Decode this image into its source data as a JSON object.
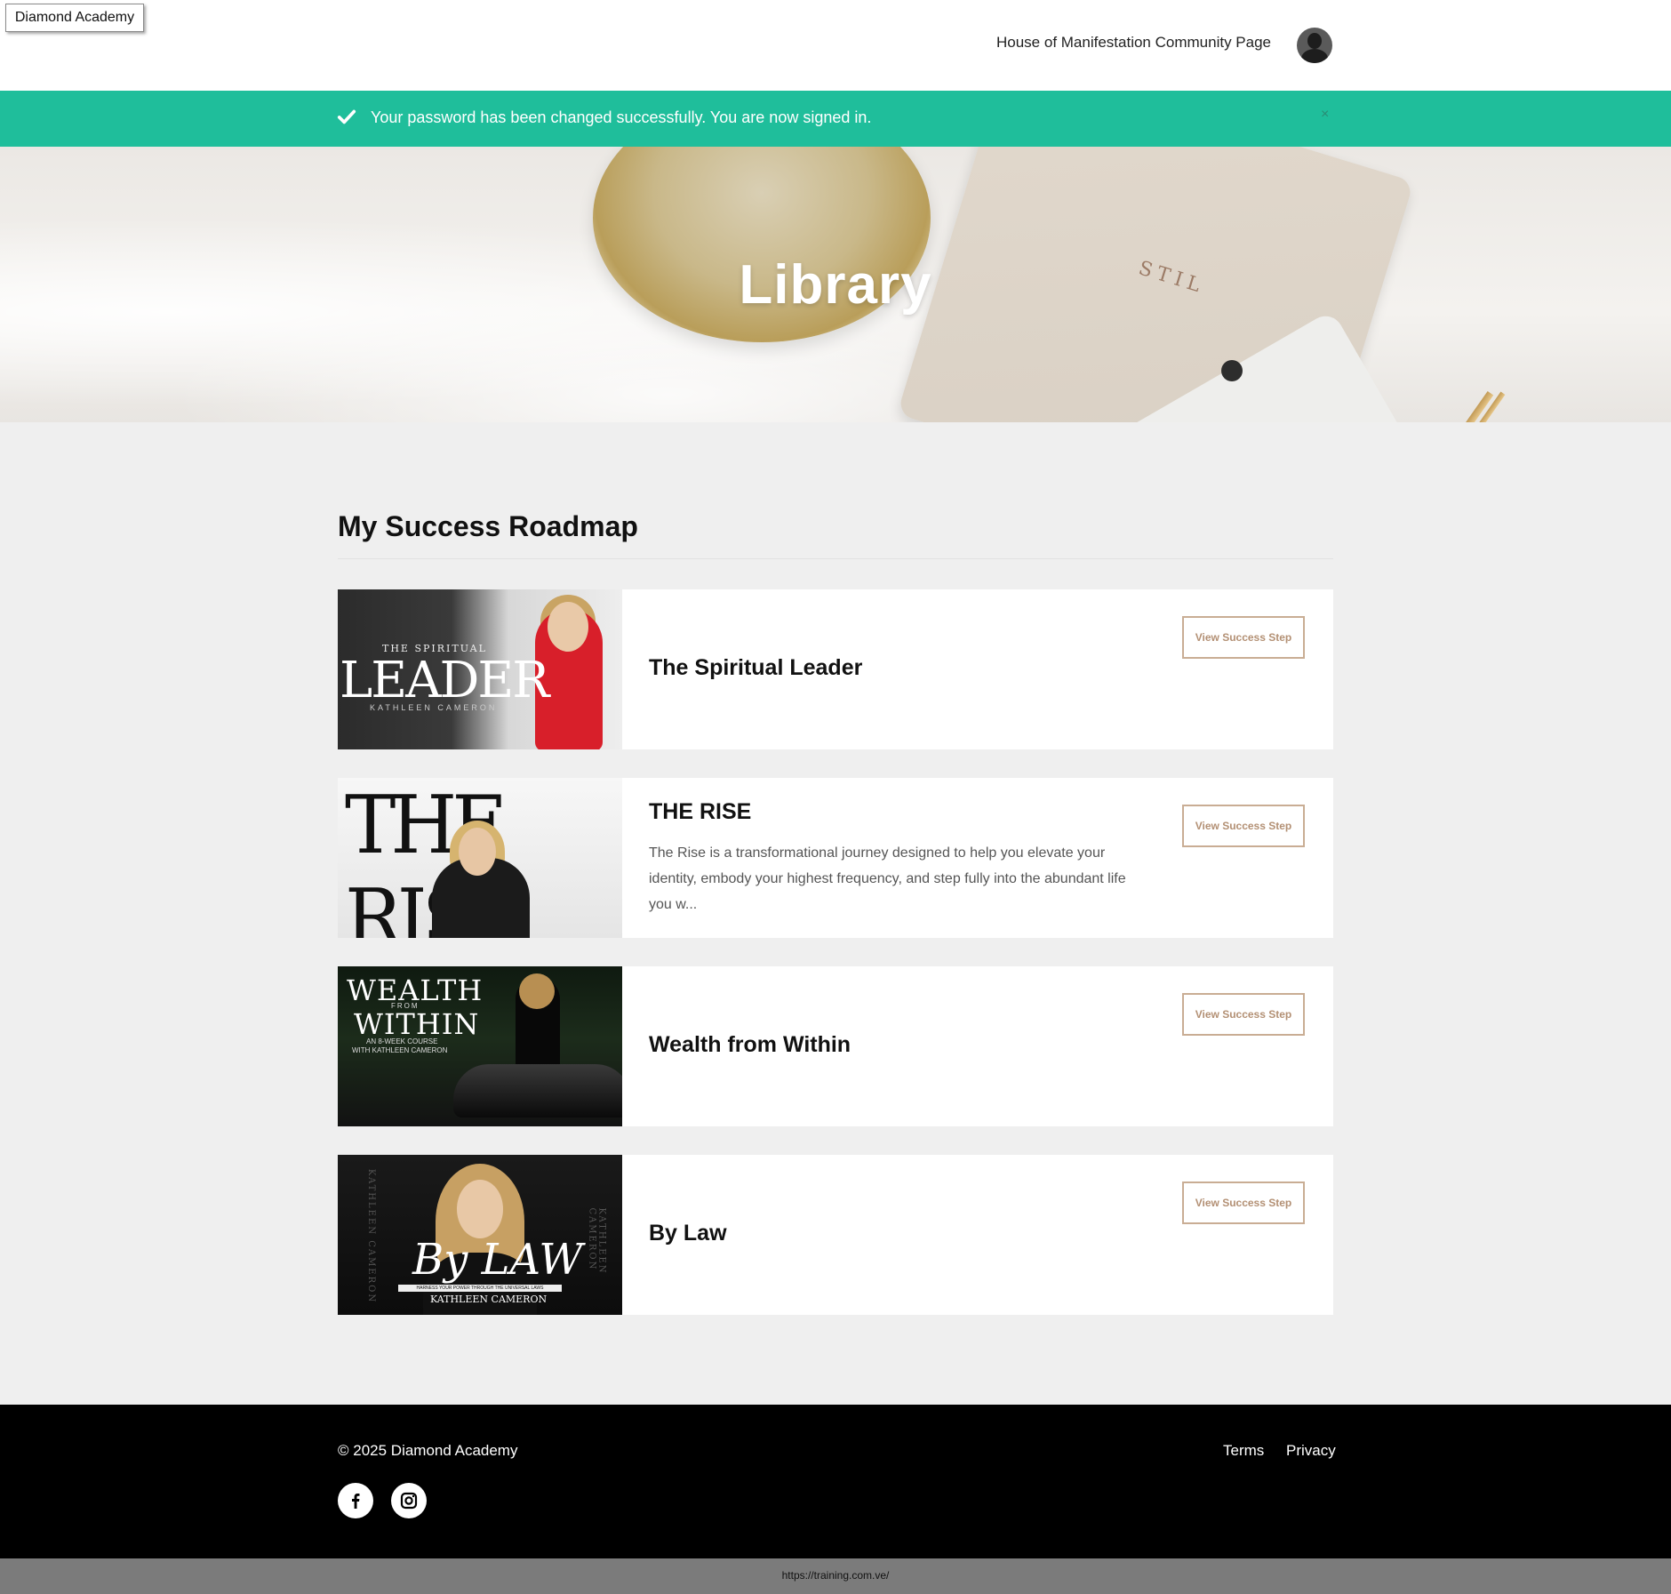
{
  "header": {
    "brand": "Diamond Academy",
    "community_link": "House of Manifestation Community Page",
    "avatar_icon": "user-avatar-icon"
  },
  "alert": {
    "message": "Your password has been changed successfully. You are now signed in.",
    "close_label": "×",
    "color": "#1fbe9b"
  },
  "hero": {
    "title": "Library",
    "notebook_text": "STIL"
  },
  "main": {
    "section_title": "My Success Roadmap",
    "courses": [
      {
        "title": "The Spiritual Leader",
        "description": "",
        "button_label": "View Success Step",
        "thumbnail": {
          "sub": "THE SPIRITUAL",
          "big": "LEADER",
          "by": "KATHLEEN CAMERON"
        }
      },
      {
        "title": "THE RISE",
        "description": "The Rise is a transformational journey designed to help you elevate your identity, embody your highest frequency, and step fully into the abundant life you w...",
        "button_label": "View Success Step",
        "thumbnail": {
          "big": "THE RISE"
        }
      },
      {
        "title": "Wealth from Within",
        "description": "",
        "button_label": "View Success Step",
        "thumbnail": {
          "l1": "WEALTH",
          "l2": "FROM",
          "l3": "WITHIN",
          "l4": "AN 8-WEEK COURSE",
          "l5": "WITH KATHLEEN CAMERON"
        }
      },
      {
        "title": "By Law",
        "description": "",
        "button_label": "View Success Step",
        "thumbnail": {
          "law": "By LAW",
          "strip": "HARNESS YOUR POWER THROUGH THE UNIVERSAL LAWS",
          "name": "KATHLEEN CAMERON",
          "side": "KATHLEEN CAMERON"
        }
      }
    ]
  },
  "footer": {
    "copyright": "© 2025 Diamond Academy",
    "terms": "Terms",
    "privacy": "Privacy",
    "social": [
      "facebook-icon",
      "instagram-icon"
    ]
  },
  "statusbar": {
    "url": "https://training.com.ve/"
  },
  "colors": {
    "accent_button": "#c9ad94",
    "alert_green": "#1fbe9b",
    "footer_bg": "#000000"
  }
}
